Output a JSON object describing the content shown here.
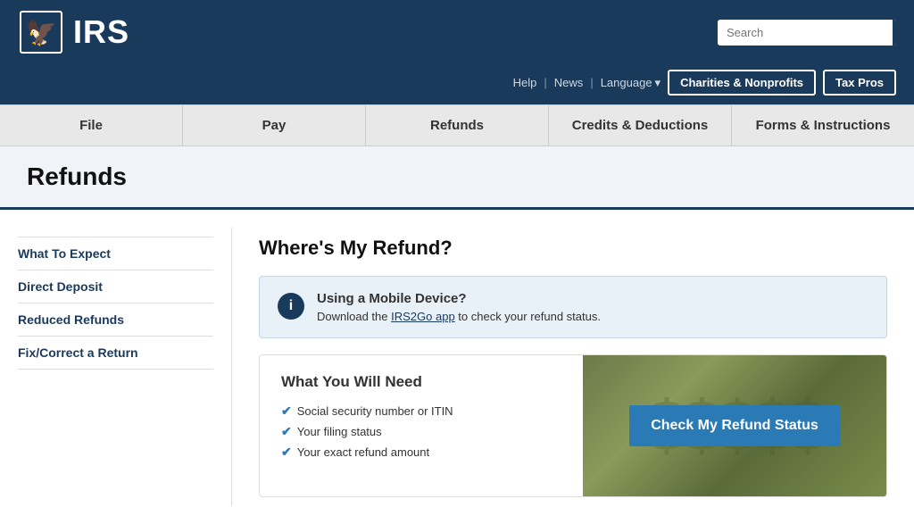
{
  "header": {
    "logo_text": "IRS",
    "search_placeholder": "Search",
    "utility": {
      "help": "Help",
      "news": "News",
      "language": "Language",
      "charities_btn": "Charities & Nonprofits",
      "taxpros_btn": "Tax Pros"
    }
  },
  "main_nav": {
    "items": [
      {
        "id": "file",
        "label": "File"
      },
      {
        "id": "pay",
        "label": "Pay"
      },
      {
        "id": "refunds",
        "label": "Refunds"
      },
      {
        "id": "credits",
        "label": "Credits & Deductions"
      },
      {
        "id": "forms",
        "label": "Forms & Instructions"
      }
    ]
  },
  "page": {
    "title": "Refunds"
  },
  "sidebar": {
    "items": [
      {
        "id": "what-to-expect",
        "label": "What To Expect"
      },
      {
        "id": "direct-deposit",
        "label": "Direct Deposit"
      },
      {
        "id": "reduced-refunds",
        "label": "Reduced Refunds"
      },
      {
        "id": "fix-correct",
        "label": "Fix/Correct a Return"
      }
    ]
  },
  "main_content": {
    "section_title": "Where's My Refund?",
    "info_box": {
      "icon": "i",
      "heading": "Using a Mobile Device?",
      "text_before_link": "Download the ",
      "link_text": "IRS2Go app",
      "text_after_link": " to check your refund status."
    },
    "action_box": {
      "heading": "What You Will Need",
      "checklist": [
        "Social security number or ITIN",
        "Your filing status",
        "Your exact refund amount"
      ],
      "cta_button": "Check My Refund Status"
    }
  }
}
